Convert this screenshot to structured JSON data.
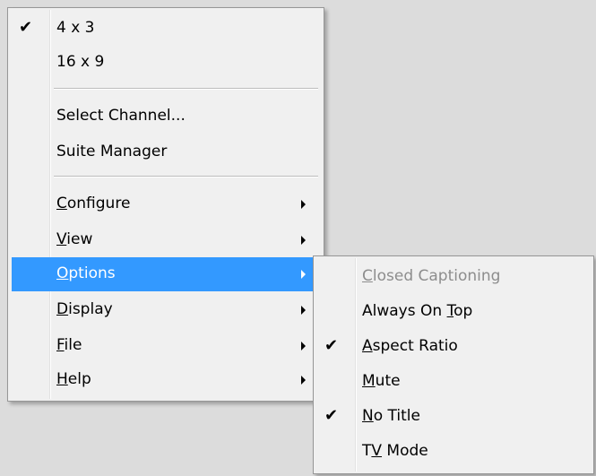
{
  "main_menu": {
    "items": [
      {
        "label": "4 x 3",
        "checked": true
      },
      {
        "label": "16 x 9"
      },
      {
        "label": "Select Channel..."
      },
      {
        "label": "Suite Manager"
      },
      {
        "pre": "",
        "ul": "C",
        "post": "onfigure",
        "submenu": true
      },
      {
        "pre": "",
        "ul": "V",
        "post": "iew",
        "submenu": true
      },
      {
        "pre": "",
        "ul": "O",
        "post": "ptions",
        "submenu": true,
        "highlighted": true
      },
      {
        "pre": "",
        "ul": "D",
        "post": "isplay",
        "submenu": true
      },
      {
        "pre": "",
        "ul": "F",
        "post": "ile",
        "submenu": true
      },
      {
        "pre": "",
        "ul": "H",
        "post": "elp",
        "submenu": true
      }
    ]
  },
  "submenu": {
    "items": [
      {
        "pre": "",
        "ul": "C",
        "post": "losed Captioning",
        "disabled": true
      },
      {
        "pre": "Always On ",
        "ul": "T",
        "post": "op"
      },
      {
        "pre": "",
        "ul": "A",
        "post": "spect Ratio",
        "checked": true
      },
      {
        "pre": "",
        "ul": "M",
        "post": "ute"
      },
      {
        "pre": "",
        "ul": "N",
        "post": "o Title",
        "checked": true
      },
      {
        "pre": "T",
        "ul": "V",
        "post": " Mode"
      }
    ]
  },
  "icons": {
    "check": "✔"
  },
  "colors": {
    "highlight": "#3399ff",
    "menu_bg": "#f0f0f0",
    "disabled_text": "#8d8d8d"
  }
}
